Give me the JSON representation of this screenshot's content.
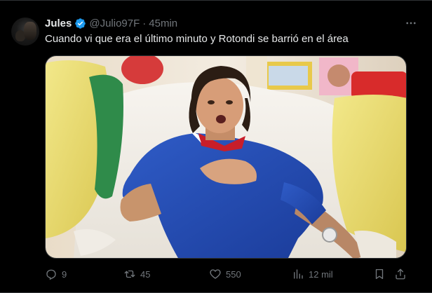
{
  "tweet": {
    "author_name": "Jules",
    "handle": "@Julio97F",
    "separator": "·",
    "time": "45min",
    "text": "Cuando vi que era el último minuto y Rotondi se barrió en el área",
    "stats": {
      "replies": "9",
      "retweets": "45",
      "likes": "550",
      "views": "12 mil"
    }
  },
  "colors": {
    "background": "#000000",
    "text_primary": "#e7e9ea",
    "text_secondary": "#71767b",
    "verified_blue": "#1d9bf0",
    "divider": "#2f3336"
  },
  "icons": {
    "verified": "verified-badge-icon",
    "more": "more-options-icon",
    "reply": "reply-icon",
    "retweet": "retweet-icon",
    "like": "heart-icon",
    "views": "analytics-icon",
    "bookmark": "bookmark-icon",
    "share": "share-icon"
  }
}
